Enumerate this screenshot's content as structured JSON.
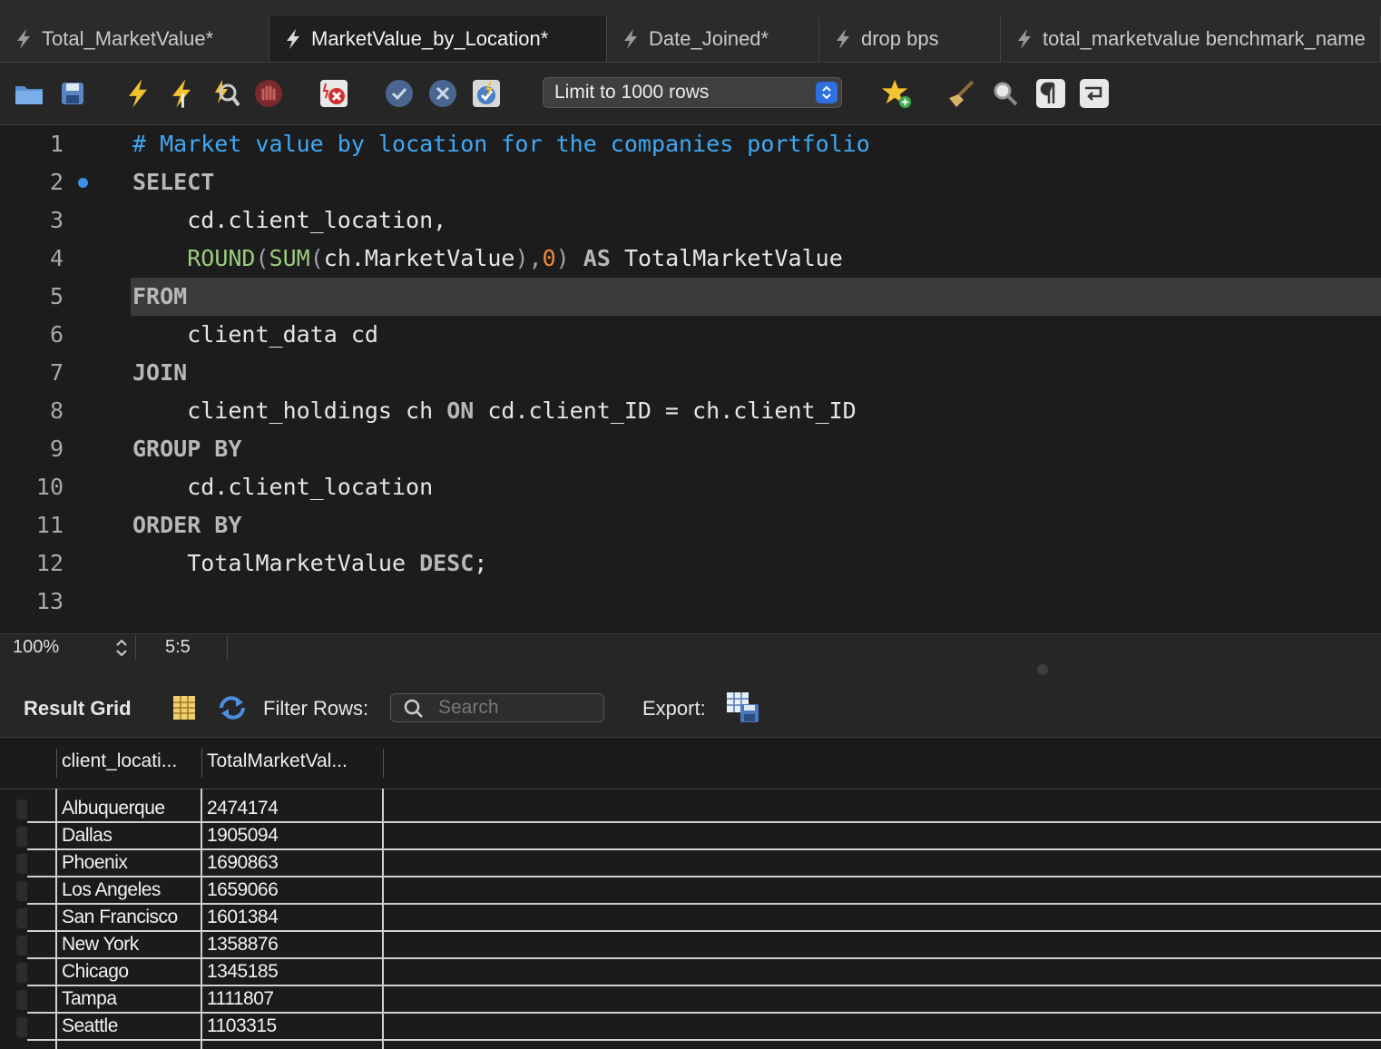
{
  "tabs": [
    {
      "label": "Total_MarketValue*"
    },
    {
      "label": "MarketValue_by_Location*"
    },
    {
      "label": "Date_Joined*"
    },
    {
      "label": "drop bps"
    },
    {
      "label": "total_marketvalue benchmark_name"
    }
  ],
  "toolbar": {
    "limit_label": "Limit to 1000 rows",
    "icons": [
      "open-folder-icon",
      "save-icon",
      "execute-icon",
      "execute-current-icon",
      "explain-icon",
      "stop-icon",
      "toggle-error-icon",
      "commit-icon",
      "rollback-icon",
      "autocommit-icon",
      "add-snippet-icon",
      "beautify-icon",
      "find-icon",
      "invisibles-icon",
      "wrap-icon"
    ]
  },
  "editor": {
    "line_numbers": [
      "1",
      "2",
      "3",
      "4",
      "5",
      "6",
      "7",
      "8",
      "9",
      "10",
      "11",
      "12",
      "13"
    ],
    "line1_comment": "# Market value by location for the companies portfolio",
    "line2_kw": "SELECT",
    "line3": "    cd.client_location,",
    "line4_fn1": "ROUND",
    "line4_fn2": "SUM",
    "line4_arg": "ch.MarketValue",
    "line4_num": "0",
    "line4_as": "AS",
    "line4_alias": "TotalMarketValue",
    "line5_kw": "FROM",
    "line6": "    client_data cd",
    "line7_kw": "JOIN",
    "line8_a": "    client_holdings ch ",
    "line8_on": "ON",
    "line8_b": " cd.client_ID = ch.client_ID",
    "line9_kw": "GROUP BY",
    "line10": "    cd.client_location",
    "line11_kw": "ORDER BY",
    "line12_a": "    TotalMarketValue ",
    "line12_desc": "DESC",
    "line12_end": ";"
  },
  "status": {
    "zoom": "100%",
    "cursor_pos": "5:5"
  },
  "results": {
    "title": "Result Grid",
    "filter_label": "Filter Rows:",
    "search_placeholder": "Search",
    "export_label": "Export:",
    "columns": [
      "client_locati...",
      "TotalMarketVal..."
    ],
    "rows": [
      [
        "Albuquerque",
        "2474174"
      ],
      [
        "Dallas",
        "1905094"
      ],
      [
        "Phoenix",
        "1690863"
      ],
      [
        "Los Angeles",
        "1659066"
      ],
      [
        "San Francisco",
        "1601384"
      ],
      [
        "New York",
        "1358876"
      ],
      [
        "Chicago",
        "1345185"
      ],
      [
        "Tampa",
        "1111807"
      ],
      [
        "Seattle",
        "1103315"
      ]
    ]
  },
  "colors": {
    "accent_blue": "#2f6fe0",
    "comment_blue": "#3fa9f5",
    "function_green": "#9ccb7f",
    "number_orange": "#f08a3a"
  }
}
